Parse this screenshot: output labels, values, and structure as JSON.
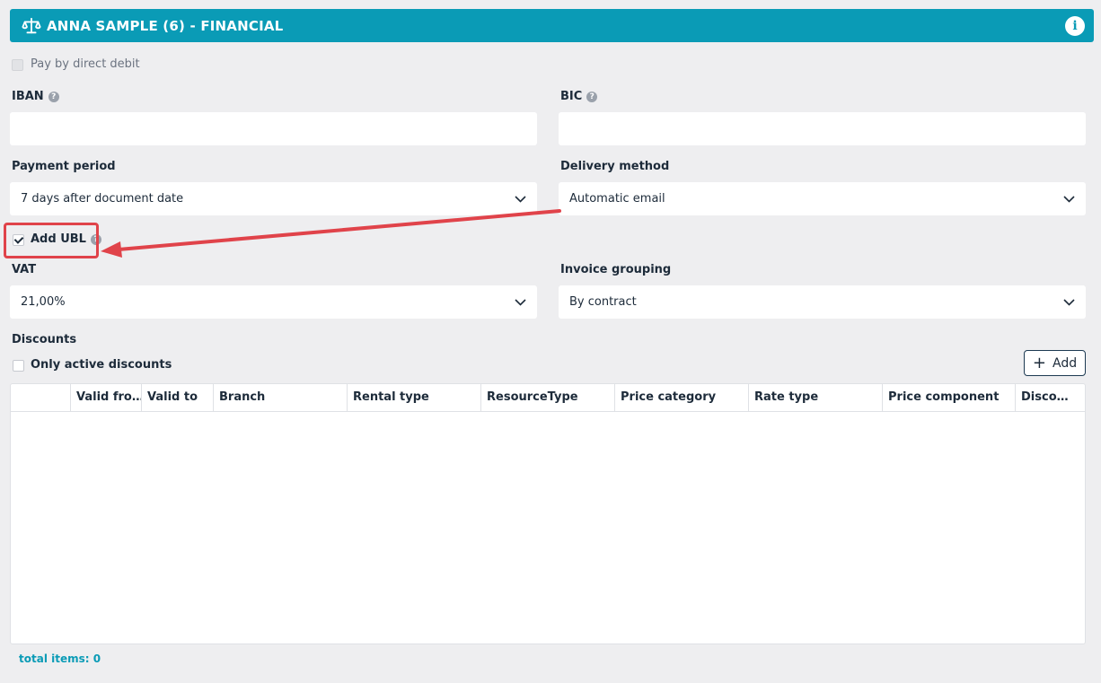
{
  "header": {
    "title": "ANNA SAMPLE (6) - FINANCIAL",
    "icon": "scale-icon",
    "info_icon": "info-icon"
  },
  "direct_debit": {
    "label": "Pay by direct debit",
    "checked": false,
    "disabled": true
  },
  "iban": {
    "label": "IBAN",
    "value": ""
  },
  "bic": {
    "label": "BIC",
    "value": ""
  },
  "payment_period": {
    "label": "Payment period",
    "value": "7 days after document date"
  },
  "delivery_method": {
    "label": "Delivery method",
    "value": "Automatic email"
  },
  "add_ubl": {
    "label": "Add UBL",
    "checked": true
  },
  "vat": {
    "label": "VAT",
    "value": "21,00%"
  },
  "invoice_grouping": {
    "label": "Invoice grouping",
    "value": "By contract"
  },
  "discounts": {
    "label": "Discounts",
    "only_active_label": "Only active discounts",
    "add_label": "Add",
    "columns": [
      "Valid fro…",
      "Valid to",
      "Branch",
      "Rental type",
      "ResourceType",
      "Price category",
      "Rate type",
      "Price component",
      "Disco…"
    ],
    "rows": [],
    "total": "total items: 0"
  },
  "colors": {
    "accent": "#0a9bb6",
    "annotation": "#e0434a"
  }
}
